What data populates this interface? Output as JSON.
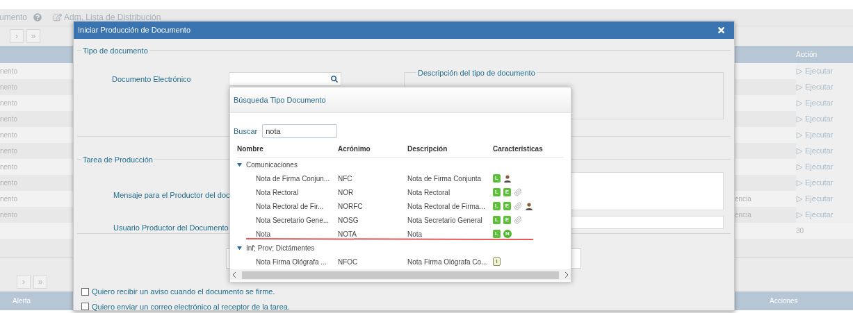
{
  "background": {
    "breadcrumb": "umento",
    "distribution_link": "Adm. Lista de Distribución",
    "pager_top": [
      "›",
      "»"
    ],
    "table": {
      "action_header": "Acción",
      "rows": [
        {
          "column_1": "nento",
          "action": "Ejecutar"
        },
        {
          "column_1": "nento",
          "action": "Ejecutar"
        },
        {
          "column_1": "nento",
          "action": "Ejecutar"
        },
        {
          "column_1": "nento",
          "action": "Ejecutar"
        },
        {
          "column_1": "nento",
          "action": "Ejecutar"
        },
        {
          "column_1": "nento",
          "action": "Ejecutar"
        },
        {
          "column_1": "nento",
          "action": "Ejecutar"
        },
        {
          "column_1": "nento",
          "action": "Ejecutar"
        },
        {
          "column_1": "nento",
          "column_3": "encia",
          "action": "Ejecutar"
        },
        {
          "column_1": "nento",
          "column_3": "encia",
          "action": "Ejecutar"
        }
      ],
      "total": "30"
    },
    "pager_bottom": [
      "›",
      "»"
    ],
    "lower_table": {
      "columns": [
        "Alerta",
        "Acciones"
      ]
    }
  },
  "dialog": {
    "title": "Iniciar Producción de Documento",
    "document_type": {
      "legend": "Tipo de documento",
      "field_label": "Documento Electrónico",
      "description_legend": "Descripción del tipo de documento"
    },
    "production_task": {
      "legend": "Tarea de Producción",
      "message_label": "Mensaje para el Productor del doc",
      "user_label": "Usuario Productor del Documento"
    },
    "options": [
      {
        "label": "Quiero recibir un aviso cuando el documento se firme.",
        "checked": false
      },
      {
        "label": "Quiero enviar un correo electrónico al receptor de la tarea.",
        "checked": false
      }
    ]
  },
  "search_popup": {
    "title": "Búsqueda Tipo Documento",
    "search_label": "Buscar",
    "search_value": "nota",
    "columns": [
      "Nombre",
      "Acrónimo",
      "Descripción",
      "Características"
    ],
    "groups": [
      {
        "name": "Comunicaciones",
        "expanded": true,
        "children": [
          {
            "name": "Nota de Firma Conjun...",
            "acronym": "NFC",
            "description": "Nota de Firma Conjunta",
            "features": [
              {
                "kind": "letter",
                "label": "L"
              },
              {
                "kind": "person"
              }
            ]
          },
          {
            "name": "Nota Rectoral",
            "acronym": "NOR",
            "description": "Nota Rectoral",
            "features": [
              {
                "kind": "letter",
                "label": "L"
              },
              {
                "kind": "letter",
                "label": "E"
              },
              {
                "kind": "clip"
              }
            ]
          },
          {
            "name": "Nota Rectoral de Fir...",
            "acronym": "NORFC",
            "description": "Nota Rectoral de Firma...",
            "features": [
              {
                "kind": "letter",
                "label": "L"
              },
              {
                "kind": "letter",
                "label": "E"
              },
              {
                "kind": "clip"
              },
              {
                "kind": "person"
              }
            ]
          },
          {
            "name": "Nota Secretario Gene...",
            "acronym": "NOSG",
            "description": "Nota Secretario General",
            "features": [
              {
                "kind": "letter",
                "label": "L"
              },
              {
                "kind": "letter",
                "label": "E"
              },
              {
                "kind": "clip"
              }
            ]
          },
          {
            "name": "Nota",
            "acronym": "NOTA",
            "description": "Nota",
            "features": [
              {
                "kind": "letter",
                "label": "L"
              },
              {
                "kind": "circle",
                "label": "N"
              }
            ]
          }
        ]
      },
      {
        "name": "Inf; Prov; Dictámentes",
        "expanded": true,
        "children": [
          {
            "name": "Nota Firma Ológrafa ...",
            "acronym": "NFOC",
            "description": "Nota Firma Ológrafa Co...",
            "features": [
              {
                "kind": "outline",
                "label": "I"
              }
            ]
          }
        ]
      }
    ]
  }
}
